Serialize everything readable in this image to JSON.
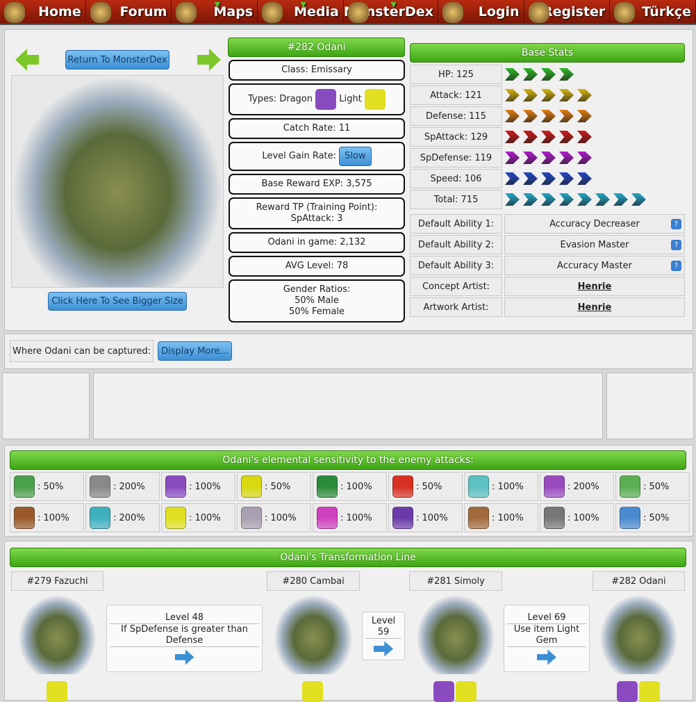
{
  "nav": [
    "Home",
    "Forum",
    "Maps",
    "Media",
    "MonsterDex",
    "Login",
    "Register",
    "Türkçe"
  ],
  "nav_dropdown": [
    false,
    false,
    true,
    true,
    true,
    false,
    false,
    false
  ],
  "buttons": {
    "return": "Return To MonsterDex",
    "bigger": "Click Here To See Bigger Size",
    "display_more": "Display More..."
  },
  "monster": {
    "title": "#282 Odani",
    "class": "Class: Emissary",
    "types_label": "Types: Dragon",
    "type2": "Light",
    "catch_rate": "Catch Rate: 11",
    "level_gain_label": "Level Gain Rate:",
    "level_gain": "Slow",
    "exp": "Base Reward EXP: 3,575",
    "tp1": "Reward TP (Training Point):",
    "tp2": "SpAttack: 3",
    "in_game": "Odani in game: 2,132",
    "avg": "AVG Level: 78",
    "gender_title": "Gender Ratios:",
    "male": "50% Male",
    "female": "50% Female"
  },
  "base_stats": {
    "title": "Base Stats",
    "stats": [
      {
        "label": "HP: 125",
        "arrows": 4,
        "color": "#2fb82a"
      },
      {
        "label": "Attack: 121",
        "arrows": 5,
        "color": "#d8b40e"
      },
      {
        "label": "Defense: 115",
        "arrows": 5,
        "color": "#e07d10"
      },
      {
        "label": "SpAttack: 129",
        "arrows": 5,
        "color": "#d01a1a"
      },
      {
        "label": "SpDefense: 119",
        "arrows": 5,
        "color": "#b21ccc"
      },
      {
        "label": "Speed: 106",
        "arrows": 5,
        "color": "#2248c8"
      },
      {
        "label": "Total: 715",
        "arrows": 8,
        "color": "#22a8c8"
      }
    ]
  },
  "abilities": [
    {
      "label": "Default Ability 1:",
      "value": "Accuracy Decreaser",
      "help": "?"
    },
    {
      "label": "Default Ability 2:",
      "value": "Evasion Master",
      "help": "?"
    },
    {
      "label": "Default Ability 3:",
      "value": "Accuracy Master",
      "help": "?"
    },
    {
      "label": "Concept Artist:",
      "value": "Henrie"
    },
    {
      "label": "Artwork Artist:",
      "value": "Henrie"
    }
  ],
  "captured_label": "Where Odani can be captured:",
  "sensitivity": {
    "title": "Odani's elemental sensitivity to the enemy attacks:",
    "items": [
      {
        "icon": "nature-icon",
        "value": ": 50%",
        "color": "#4aa04a"
      },
      {
        "icon": "yin-yang-icon",
        "value": ": 200%",
        "color": "#888"
      },
      {
        "icon": "dragon-icon",
        "value": ": 100%",
        "color": "#8a4ac0"
      },
      {
        "icon": "electric-icon",
        "value": ": 50%",
        "color": "#d8d810"
      },
      {
        "icon": "fist-icon",
        "value": ": 100%",
        "color": "#2a8a3a"
      },
      {
        "icon": "fire-icon",
        "value": ": 50%",
        "color": "#d83020"
      },
      {
        "icon": "water-icon",
        "value": ": 100%",
        "color": "#5ac0c0"
      },
      {
        "icon": "ghost-icon",
        "value": ": 200%",
        "color": "#9a4ac0"
      },
      {
        "icon": "leaf-icon",
        "value": ": 50%",
        "color": "#5ab050"
      },
      {
        "icon": "earth-icon",
        "value": ": 100%",
        "color": "#9a5a2a"
      },
      {
        "icon": "ice-icon",
        "value": ": 200%",
        "color": "#40b0c0"
      },
      {
        "icon": "light-icon",
        "value": ": 100%",
        "color": "#e0e020"
      },
      {
        "icon": "swirl-icon",
        "value": ": 100%",
        "color": "#a8a0b0"
      },
      {
        "icon": "poison-icon",
        "value": ": 100%",
        "color": "#d040c0"
      },
      {
        "icon": "psychic-icon",
        "value": ": 100%",
        "color": "#6a3aa8"
      },
      {
        "icon": "rock-icon",
        "value": ": 100%",
        "color": "#a06a3a"
      },
      {
        "icon": "metal-icon",
        "value": ": 100%",
        "color": "#777"
      },
      {
        "icon": "wind-icon",
        "value": ": 50%",
        "color": "#4a8ad0"
      }
    ]
  },
  "transformation": {
    "title": "Odani's Transformation Line",
    "monsters": [
      "#279 Fazuchi",
      "#280 Cambai",
      "#281 Simoly",
      "#282 Odani"
    ],
    "steps": [
      {
        "level": "Level 48",
        "cond": "If SpDefense is greater than Defense"
      },
      {
        "level": "Level 59",
        "cond": ""
      },
      {
        "level": "Level 69",
        "cond": "Use item Light Gem"
      }
    ]
  }
}
